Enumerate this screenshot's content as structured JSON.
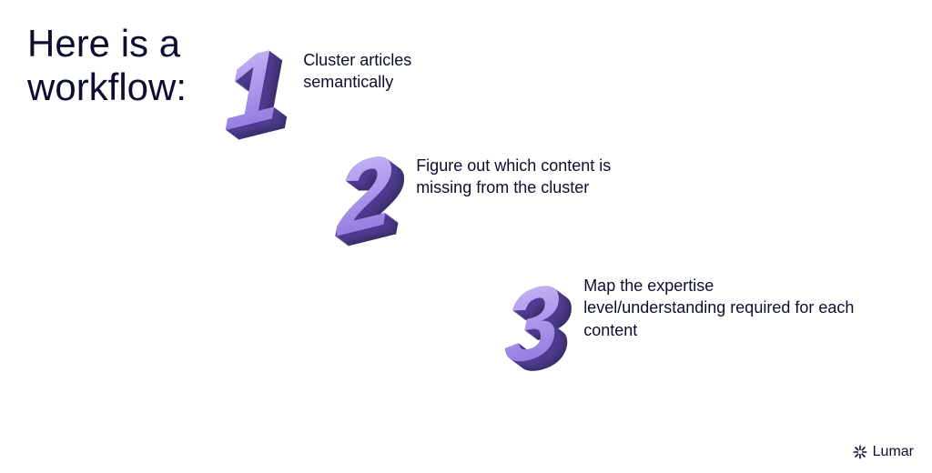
{
  "title": "Here is a workflow:",
  "steps": [
    {
      "num": "1",
      "text": "Cluster articles semantically"
    },
    {
      "num": "2",
      "text": "Figure out which content is missing from the cluster"
    },
    {
      "num": "3",
      "text": "Map the expertise level/understanding required for each content"
    }
  ],
  "brand": {
    "name": "Lumar",
    "icon": "brand-mark"
  }
}
